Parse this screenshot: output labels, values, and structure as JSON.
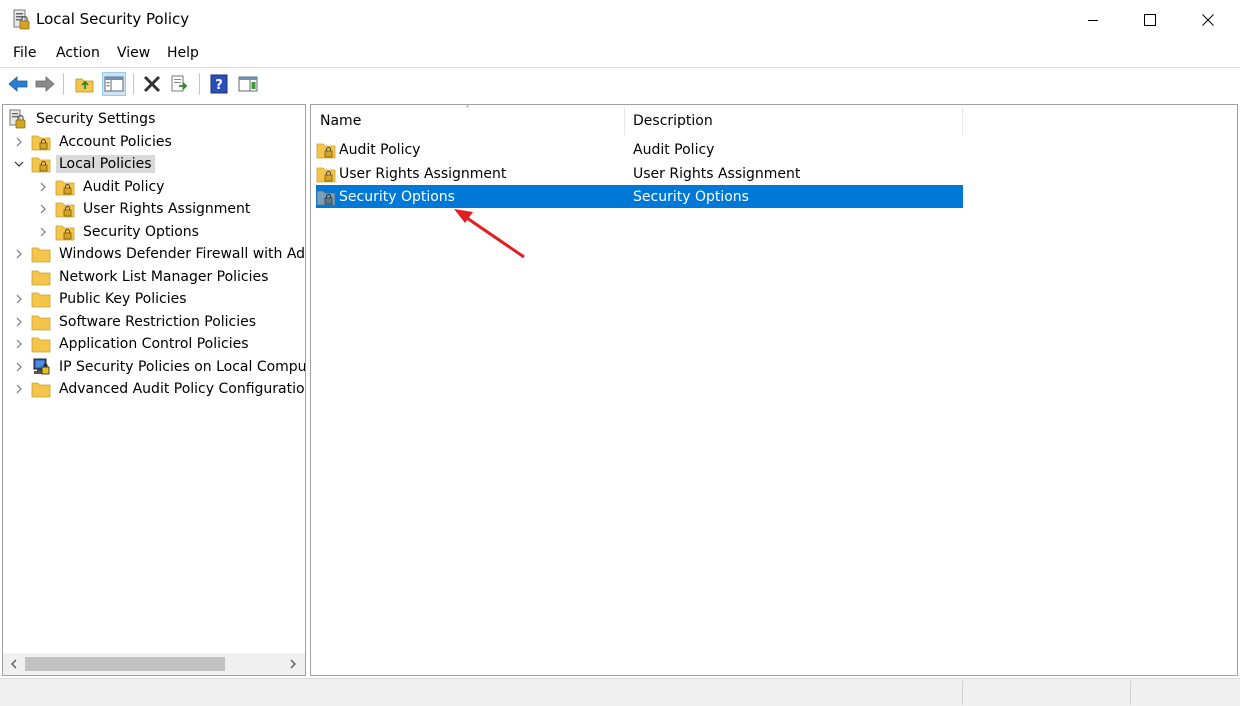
{
  "window": {
    "title": "Local Security Policy"
  },
  "menu": [
    "File",
    "Action",
    "View",
    "Help"
  ],
  "toolbar": {
    "buttons": [
      "back-icon",
      "forward-icon",
      "up-folder-icon",
      "show-hide-tree-icon",
      "delete-icon",
      "export-list-icon",
      "help-icon",
      "properties-icon"
    ]
  },
  "tree": {
    "root": "Security Settings",
    "items": [
      {
        "label": "Account Policies",
        "expanded": false,
        "level": 1
      },
      {
        "label": "Local Policies",
        "expanded": true,
        "level": 1,
        "selected": true
      },
      {
        "label": "Audit Policy",
        "level": 2
      },
      {
        "label": "User Rights Assignment",
        "level": 2
      },
      {
        "label": "Security Options",
        "level": 2
      },
      {
        "label": "Windows Defender Firewall with Advar",
        "level": 1
      },
      {
        "label": "Network List Manager Policies",
        "level": 1
      },
      {
        "label": "Public Key Policies",
        "level": 1
      },
      {
        "label": "Software Restriction Policies",
        "level": 1
      },
      {
        "label": "Application Control Policies",
        "level": 1
      },
      {
        "label": "IP Security Policies on Local Computer",
        "level": 1
      },
      {
        "label": "Advanced Audit Policy Configuration",
        "level": 1
      }
    ]
  },
  "list": {
    "columns": [
      "Name",
      "Description"
    ],
    "rows": [
      {
        "name": "Audit Policy",
        "description": "Audit Policy"
      },
      {
        "name": "User Rights Assignment",
        "description": "User Rights Assignment"
      },
      {
        "name": "Security Options",
        "description": "Security Options",
        "selected": true
      }
    ]
  },
  "colors": {
    "selection": "#0078d7",
    "annotation_arrow": "#e02020",
    "folder": "#f4c54a"
  }
}
